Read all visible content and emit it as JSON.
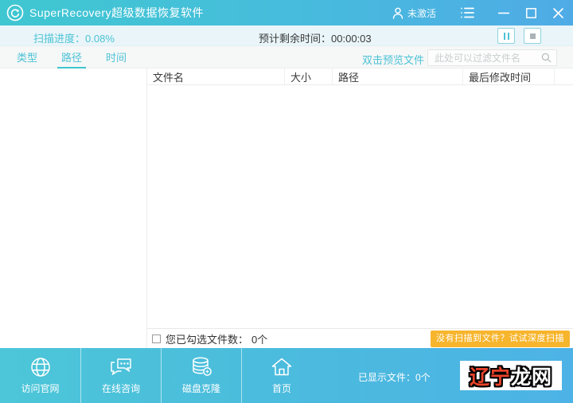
{
  "window": {
    "title": "SuperRecovery超级数据恢复软件",
    "activation_status": "未激活"
  },
  "statusbar": {
    "scan_progress_label": "扫描进度：",
    "scan_progress_value": "0.08%",
    "eta_label": "预计剩余时间：",
    "eta_value": "00:00:03"
  },
  "tabs": [
    {
      "label": "类型"
    },
    {
      "label": "路径"
    },
    {
      "label": "时间"
    }
  ],
  "filter_bar": {
    "preview_hint": "双击预览文件",
    "search_placeholder": "此处可以过滤文件名"
  },
  "file_table": {
    "columns": [
      "文件名",
      "大小",
      "路径",
      "最后修改时间"
    ],
    "rows": []
  },
  "selection_bar": {
    "checked_count_label": "您已勾选文件数：",
    "checked_count_value": "0个",
    "deep_scan_button": "没有扫描到文件？试试深度扫描"
  },
  "toolbar": {
    "items": [
      {
        "label": "访问官网",
        "icon": "globe-icon"
      },
      {
        "label": "在线咨询",
        "icon": "chat-icon"
      },
      {
        "label": "磁盘克隆",
        "icon": "disk-clone-icon"
      },
      {
        "label": "首页",
        "icon": "home-icon"
      }
    ],
    "files_shown_label": "已显示文件：",
    "files_shown_value": "0个"
  },
  "watermark": {
    "text_red": "辽宁",
    "text_white": "龙网"
  },
  "colors": {
    "accent_teal": "#4cc3d5",
    "titlebar_gradient_start": "#3fc7d1",
    "titlebar_gradient_end": "#4fabe6",
    "statusbar_bg": "#e9f5f9",
    "deep_scan_orange": "#f7b52d",
    "watermark_red": "#e8442a"
  }
}
